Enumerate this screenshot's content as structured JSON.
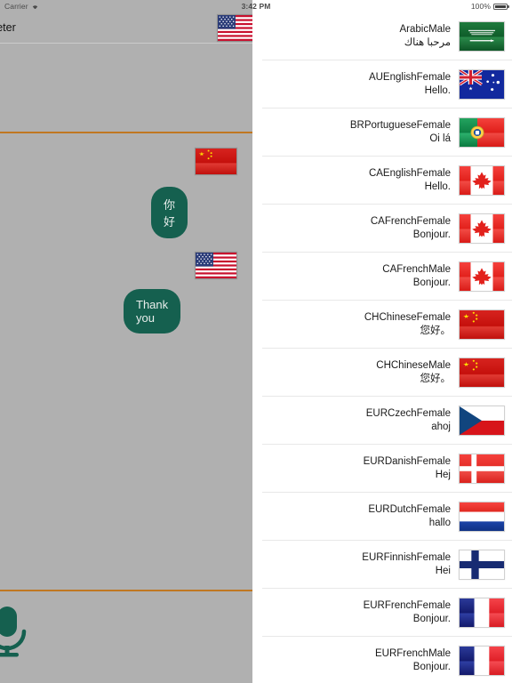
{
  "status_bar": {
    "carrier": "Carrier",
    "wifi_icon": "wifi-icon",
    "time": "3:42 PM",
    "battery_percent": "100%",
    "battery_icon": "battery-full-icon"
  },
  "left_panel": {
    "title": "erpreter",
    "header_flag": "us-flag",
    "mic_icon": "microphone-icon",
    "accent_color": "#c07722",
    "bubble_color": "#15604f",
    "background_color": "#b0b0b0",
    "messages": [
      {
        "text": "你好",
        "flag": "cn-flag"
      },
      {
        "text": "Thank you",
        "flag": "us-flag"
      }
    ]
  },
  "voice_list": {
    "rows": [
      {
        "name": "ArabicMale",
        "sample": "مرحبا هناك",
        "flag": "sa-flag"
      },
      {
        "name": "AUEnglishFemale",
        "sample": "Hello.",
        "flag": "au-flag"
      },
      {
        "name": "BRPortugueseFemale",
        "sample": "Oi lá",
        "flag": "pt-flag"
      },
      {
        "name": "CAEnglishFemale",
        "sample": "Hello.",
        "flag": "ca-flag"
      },
      {
        "name": "CAFrenchFemale",
        "sample": "Bonjour.",
        "flag": "ca-flag"
      },
      {
        "name": "CAFrenchMale",
        "sample": "Bonjour.",
        "flag": "ca-flag"
      },
      {
        "name": "CHChineseFemale",
        "sample": "您好。",
        "flag": "cn-flag"
      },
      {
        "name": "CHChineseMale",
        "sample": "您好。",
        "flag": "cn-flag"
      },
      {
        "name": "EURCzechFemale",
        "sample": "ahoj",
        "flag": "cz-flag"
      },
      {
        "name": "EURDanishFemale",
        "sample": "Hej",
        "flag": "dk-flag"
      },
      {
        "name": "EURDutchFemale",
        "sample": "hallo",
        "flag": "nl-flag"
      },
      {
        "name": "EURFinnishFemale",
        "sample": "Hei",
        "flag": "fi-flag"
      },
      {
        "name": "EURFrenchFemale",
        "sample": "Bonjour.",
        "flag": "fr-flag"
      },
      {
        "name": "EURFrenchMale",
        "sample": "Bonjour.",
        "flag": "fr-flag"
      }
    ]
  }
}
